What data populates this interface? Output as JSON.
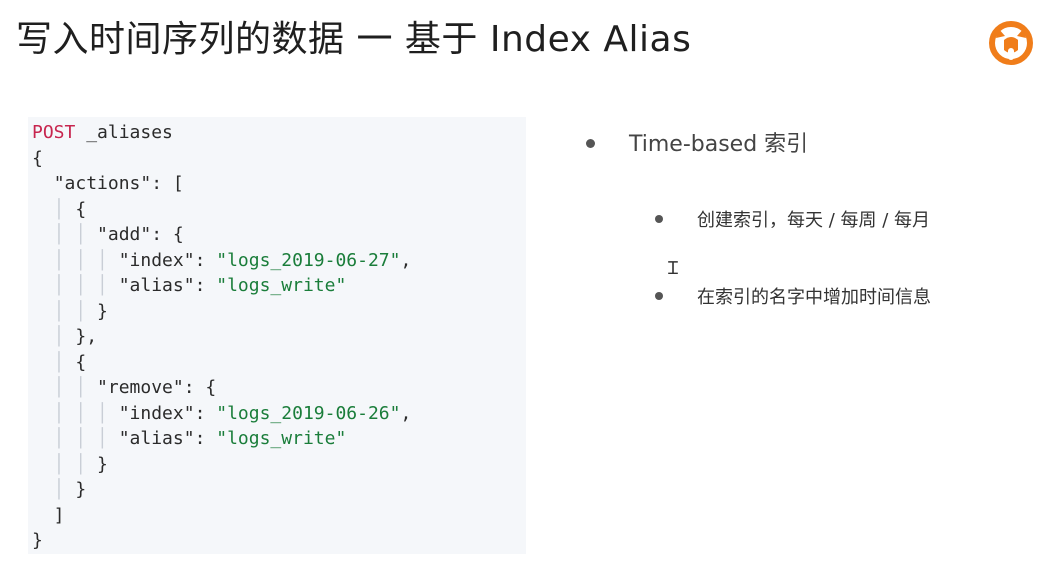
{
  "slide": {
    "title": "写入时间序列的数据 一 基于 Index Alias",
    "logo_icon": "orange-mascot-logo"
  },
  "code": {
    "lines": [
      {
        "parts": [
          {
            "t": "POST",
            "c": "kw"
          },
          {
            "t": " _aliases",
            "c": "plain"
          }
        ]
      },
      {
        "parts": [
          {
            "t": "{",
            "c": "plain"
          }
        ]
      },
      {
        "parts": [
          {
            "t": "  ",
            "c": "plain"
          },
          {
            "t": "\"actions\"",
            "c": "plain"
          },
          {
            "t": ": [",
            "c": "plain"
          }
        ]
      },
      {
        "parts": [
          {
            "t": "  │ ",
            "c": "guide"
          },
          {
            "t": "{",
            "c": "plain"
          }
        ]
      },
      {
        "parts": [
          {
            "t": "  │ │ ",
            "c": "guide"
          },
          {
            "t": "\"add\"",
            "c": "plain"
          },
          {
            "t": ": {",
            "c": "plain"
          }
        ]
      },
      {
        "parts": [
          {
            "t": "  │ │ │ ",
            "c": "guide"
          },
          {
            "t": "\"index\"",
            "c": "plain"
          },
          {
            "t": ": ",
            "c": "plain"
          },
          {
            "t": "\"logs_2019-06-27\"",
            "c": "str"
          },
          {
            "t": ",",
            "c": "plain"
          }
        ]
      },
      {
        "parts": [
          {
            "t": "  │ │ │ ",
            "c": "guide"
          },
          {
            "t": "\"alias\"",
            "c": "plain"
          },
          {
            "t": ": ",
            "c": "plain"
          },
          {
            "t": "\"logs_write\"",
            "c": "str"
          }
        ]
      },
      {
        "parts": [
          {
            "t": "  │ │ ",
            "c": "guide"
          },
          {
            "t": "}",
            "c": "plain"
          }
        ]
      },
      {
        "parts": [
          {
            "t": "  │ ",
            "c": "guide"
          },
          {
            "t": "},",
            "c": "plain"
          }
        ]
      },
      {
        "parts": [
          {
            "t": "  │ ",
            "c": "guide"
          },
          {
            "t": "{",
            "c": "plain"
          }
        ]
      },
      {
        "parts": [
          {
            "t": "  │ │ ",
            "c": "guide"
          },
          {
            "t": "\"remove\"",
            "c": "plain"
          },
          {
            "t": ": {",
            "c": "plain"
          }
        ]
      },
      {
        "parts": [
          {
            "t": "  │ │ │ ",
            "c": "guide"
          },
          {
            "t": "\"index\"",
            "c": "plain"
          },
          {
            "t": ": ",
            "c": "plain"
          },
          {
            "t": "\"logs_2019-06-26\"",
            "c": "str"
          },
          {
            "t": ",",
            "c": "plain"
          }
        ]
      },
      {
        "parts": [
          {
            "t": "  │ │ │ ",
            "c": "guide"
          },
          {
            "t": "\"alias\"",
            "c": "plain"
          },
          {
            "t": ": ",
            "c": "plain"
          },
          {
            "t": "\"logs_write\"",
            "c": "str"
          }
        ]
      },
      {
        "parts": [
          {
            "t": "  │ │ ",
            "c": "guide"
          },
          {
            "t": "}",
            "c": "plain"
          }
        ]
      },
      {
        "parts": [
          {
            "t": "  │ ",
            "c": "guide"
          },
          {
            "t": "}",
            "c": "plain"
          }
        ]
      },
      {
        "parts": [
          {
            "t": "  ]",
            "c": "plain"
          }
        ]
      },
      {
        "parts": [
          {
            "t": "}",
            "c": "plain"
          }
        ]
      }
    ]
  },
  "bullets": {
    "main": "Time-based 索引",
    "sub": [
      "创建索引，每天 / 每周 / 每月",
      "在索引的名字中增加时间信息"
    ]
  },
  "colors": {
    "keyword": "#c7254e",
    "string": "#1a7d3a",
    "code_background": "#f5f7fa",
    "logo": "#f07d1a"
  },
  "cursor_icon": "text-cursor-icon"
}
